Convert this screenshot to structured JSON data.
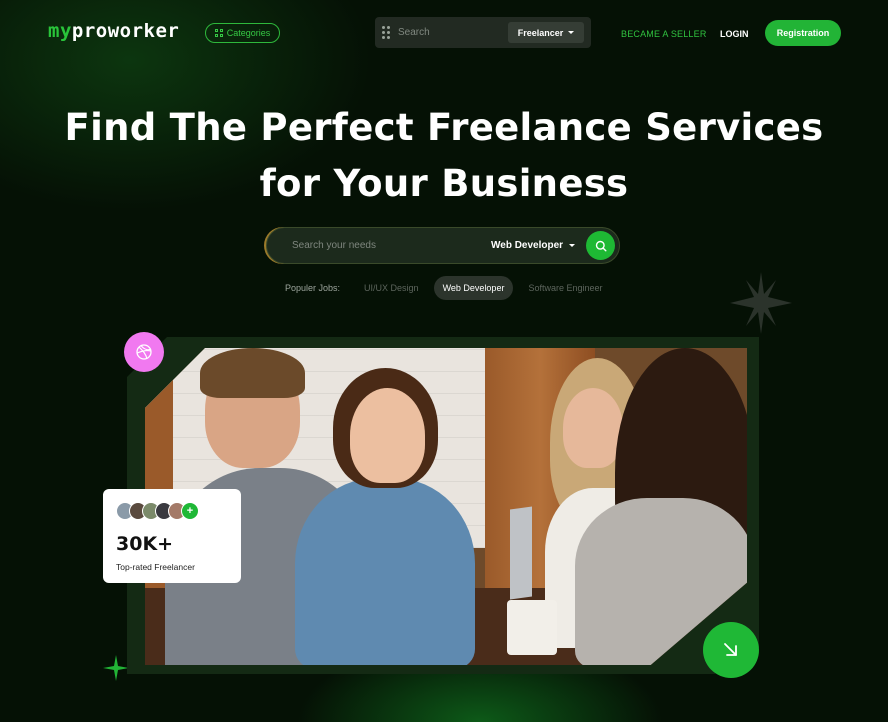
{
  "nav": {
    "logo_my": "my",
    "logo_rest": "proworker",
    "categories_label": "Categories",
    "search_placeholder": "Search",
    "search_type": "Freelancer",
    "became_seller": "BECAME A SELLER",
    "login": "LOGIN",
    "registration": "Registration"
  },
  "hero": {
    "title_line1": "Find The Perfect Freelance Services",
    "title_line2": "for Your Business",
    "search_placeholder": "Search your needs",
    "search_category": "Web Developer"
  },
  "popular": {
    "label": "Populer Jobs:",
    "chips": [
      "UI/UX Design",
      "Web Developer",
      "Software Engineer"
    ],
    "active_index": 1
  },
  "stat_card": {
    "value": "30K+",
    "label": "Top-rated Freelancer",
    "plus": "+"
  },
  "colors": {
    "accent": "#22b436",
    "pink": "#f179f0",
    "background": "#051105"
  },
  "icons": [
    "grid-icon",
    "drag-dots-icon",
    "chevron-down-icon",
    "search-icon",
    "dribbble-icon",
    "arrow-down-right-icon",
    "sparkle-icon"
  ]
}
